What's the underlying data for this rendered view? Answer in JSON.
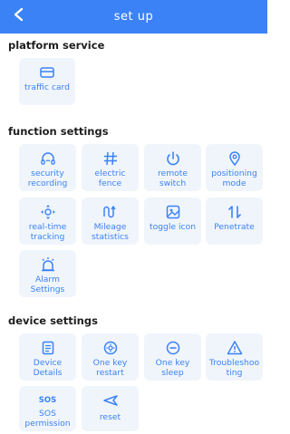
{
  "header": {
    "title": "set up"
  },
  "sections": {
    "platform": {
      "title": "platform service",
      "items": [
        {
          "label": "traffic card",
          "icon": "card-icon"
        }
      ]
    },
    "function": {
      "title": "function settings",
      "items": [
        {
          "label": "security recording",
          "icon": "headset-icon"
        },
        {
          "label": "electric fence",
          "icon": "hash-icon"
        },
        {
          "label": "remote switch",
          "icon": "power-icon"
        },
        {
          "label": "positioning mode",
          "icon": "location-pin-icon"
        },
        {
          "label": "real-time tracking",
          "icon": "tracking-icon"
        },
        {
          "label": "Mileage statistics",
          "icon": "mileage-icon"
        },
        {
          "label": "toggle icon",
          "icon": "image-icon"
        },
        {
          "label": "Penetrate",
          "icon": "arrows-updown-icon"
        },
        {
          "label": "Alarm Settings",
          "icon": "alarm-icon"
        }
      ]
    },
    "device": {
      "title": "device settings",
      "items": [
        {
          "label": "Device Details",
          "icon": "details-icon"
        },
        {
          "label": "One key restart",
          "icon": "restart-icon"
        },
        {
          "label": "One key sleep",
          "icon": "sleep-icon"
        },
        {
          "label": "Troubleshooting",
          "icon": "warning-icon"
        },
        {
          "label": "SOS permission",
          "icon": "sos-icon",
          "icon_text": "SOS"
        },
        {
          "label": "reset",
          "icon": "reset-icon"
        }
      ]
    }
  },
  "colors": {
    "accent": "#3b82f6",
    "tile_bg": "#f0f5fb"
  }
}
